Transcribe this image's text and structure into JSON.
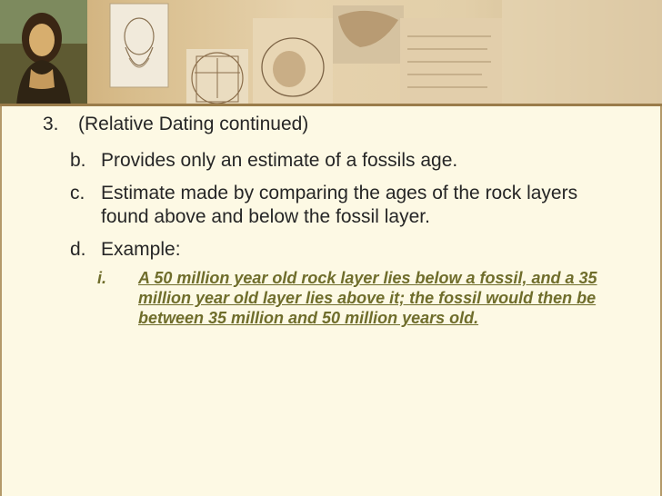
{
  "item": {
    "number": "3.",
    "heading": "(Relative Dating continued)"
  },
  "points": [
    {
      "marker": "b.",
      "lines": [
        "Provides only an estimate of a fossils age."
      ]
    },
    {
      "marker": "c.",
      "lines": [
        "Estimate made by comparing the ages of the rock layers",
        "found above and below the fossil layer."
      ]
    },
    {
      "marker": "d.",
      "lines": [
        "Example:"
      ]
    }
  ],
  "example": {
    "marker": "i.",
    "lines": [
      "A 50 million year old rock layer lies below a fossil, and a 35",
      "million year old layer lies above it; the fossil would then be",
      "between 35 million and 50 million years old."
    ]
  },
  "colors": {
    "body_text": "#262626",
    "example_text": "#6f6d2b",
    "slide_background": "#fdf9e4"
  }
}
